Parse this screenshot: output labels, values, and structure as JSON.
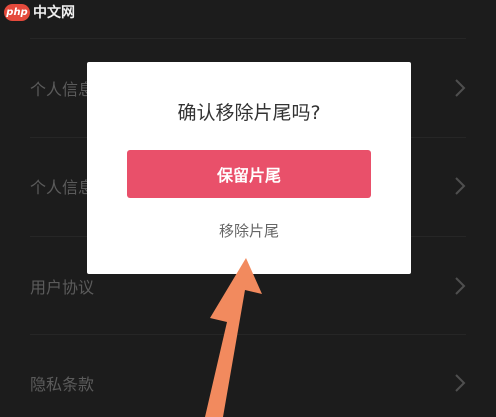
{
  "watermark": {
    "logo": "php",
    "text": "中文网"
  },
  "settings_list": {
    "items": [
      {
        "label": "个人信息"
      },
      {
        "label": "个人信息"
      },
      {
        "label": "用户协议"
      },
      {
        "label": "隐私条款"
      }
    ]
  },
  "dialog": {
    "title": "确认移除片尾吗?",
    "keep_button": "保留片尾",
    "remove_button": "移除片尾"
  },
  "colors": {
    "background": "#2b2b2b",
    "primary_button": "#e9506a",
    "annotation_arrow": "#f28a5e"
  },
  "icons": {
    "row_chevron": "chevron-right-icon",
    "annotation": "arrow-icon"
  }
}
